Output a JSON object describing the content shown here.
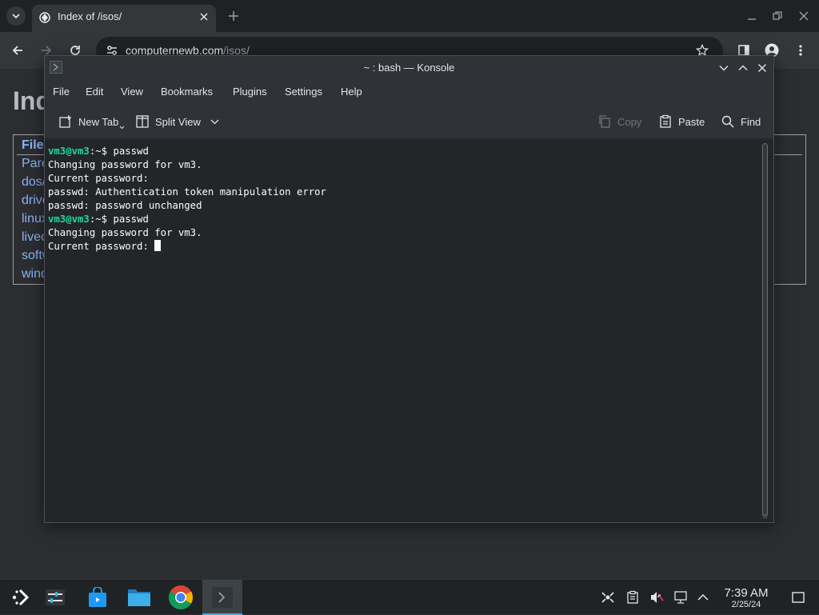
{
  "browser": {
    "tab_title": "Index of /isos/",
    "url_host": "computernewb.com",
    "url_path": "/isos/"
  },
  "page": {
    "heading": "Ind",
    "header_cell": "File",
    "links": [
      "Pare",
      "dos/",
      "drive",
      "linux",
      "livec",
      "softw",
      "wind"
    ]
  },
  "konsole": {
    "title": "~ : bash — Konsole",
    "menu": [
      "File",
      "Edit",
      "View",
      "Bookmarks",
      "Plugins",
      "Settings",
      "Help"
    ],
    "toolbar": {
      "new_tab": "New Tab",
      "split_view": "Split View",
      "copy": "Copy",
      "paste": "Paste",
      "find": "Find"
    },
    "terminal": {
      "prompt_user": "vm3@vm3",
      "prompt_path": ":~$ ",
      "lines": [
        {
          "type": "prompt",
          "cmd": "passwd"
        },
        {
          "type": "out",
          "text": "Changing password for vm3."
        },
        {
          "type": "out",
          "text": "Current password:"
        },
        {
          "type": "out",
          "text": "passwd: Authentication token manipulation error"
        },
        {
          "type": "out",
          "text": "passwd: password unchanged"
        },
        {
          "type": "prompt",
          "cmd": "passwd"
        },
        {
          "type": "out",
          "text": "Changing password for vm3."
        },
        {
          "type": "out",
          "text": "Current password: ",
          "cursor": true
        }
      ]
    }
  },
  "taskbar": {
    "apps": [
      "application-launcher-icon",
      "system-settings-icon",
      "discover-store-icon",
      "file-manager-icon",
      "chrome-icon",
      "konsole-icon"
    ],
    "active_app": "konsole-icon",
    "clock_time": "7:39 AM",
    "clock_date": "2/25/24"
  },
  "colors": {
    "prompt_green": "#1cdc9a",
    "accent": "#3daee9",
    "link_blue": "#8ab4f8"
  }
}
